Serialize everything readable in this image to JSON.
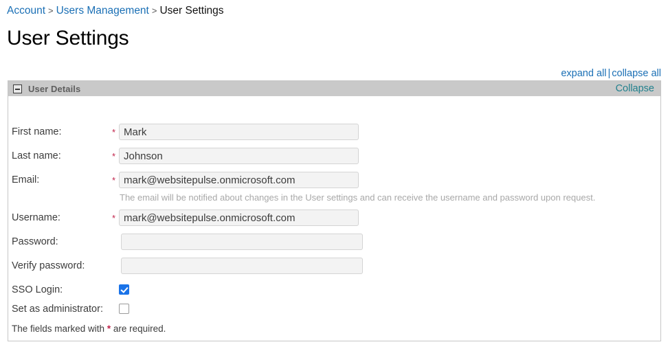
{
  "breadcrumb": {
    "items": [
      {
        "label": "Account",
        "link": true
      },
      {
        "label": "Users Management",
        "link": true
      },
      {
        "label": "User Settings",
        "link": false
      }
    ],
    "separator": ">"
  },
  "page": {
    "title": "User Settings"
  },
  "toolbar": {
    "expand_all": "expand all",
    "separator": "|",
    "collapse_all": "collapse all"
  },
  "panel": {
    "title": "User Details",
    "toggle_icon": "minus-box-icon",
    "collapse_label": "Collapse"
  },
  "form": {
    "fields": [
      {
        "label": "First name:",
        "required": true,
        "required_marker": "*",
        "value": "Mark",
        "placeholder": "",
        "type": "text",
        "name": "first-name"
      },
      {
        "label": "Last name:",
        "required": true,
        "required_marker": "*",
        "value": "Johnson",
        "placeholder": "",
        "type": "text",
        "name": "last-name"
      },
      {
        "label": "Email:",
        "required": true,
        "required_marker": "*",
        "value": "mark@websitepulse.onmicrosoft.com",
        "placeholder": "",
        "type": "text",
        "name": "email"
      },
      {
        "label": "Username:",
        "required": true,
        "required_marker": "*",
        "value": "mark@websitepulse.onmicrosoft.com",
        "placeholder": "",
        "type": "text",
        "name": "username"
      },
      {
        "label": "Password:",
        "required": false,
        "required_marker": "",
        "value": "",
        "placeholder": "",
        "type": "password",
        "name": "password"
      },
      {
        "label": "Verify password:",
        "required": false,
        "required_marker": "",
        "value": "",
        "placeholder": "",
        "type": "password",
        "name": "verify-password"
      }
    ],
    "email_help": "The email will be notified about changes in the User settings and can receive the username and password upon request.",
    "checkboxes": [
      {
        "label": "SSO Login:",
        "checked": true,
        "name": "sso-login"
      },
      {
        "label": "Set as administrator:",
        "checked": false,
        "name": "set-as-administrator"
      }
    ],
    "footer_note_before": "The fields marked with ",
    "footer_note_star": "*",
    "footer_note_after": " are required."
  },
  "colors": {
    "link": "#1a6fb5",
    "collapse_link": "#21808d",
    "required_star": "#c1244b",
    "checkbox_checked": "#1a73e8",
    "panel_header_bg": "#c9c9c9",
    "panel_title": "#5e5e5e",
    "help_text": "#a8a8a8"
  }
}
